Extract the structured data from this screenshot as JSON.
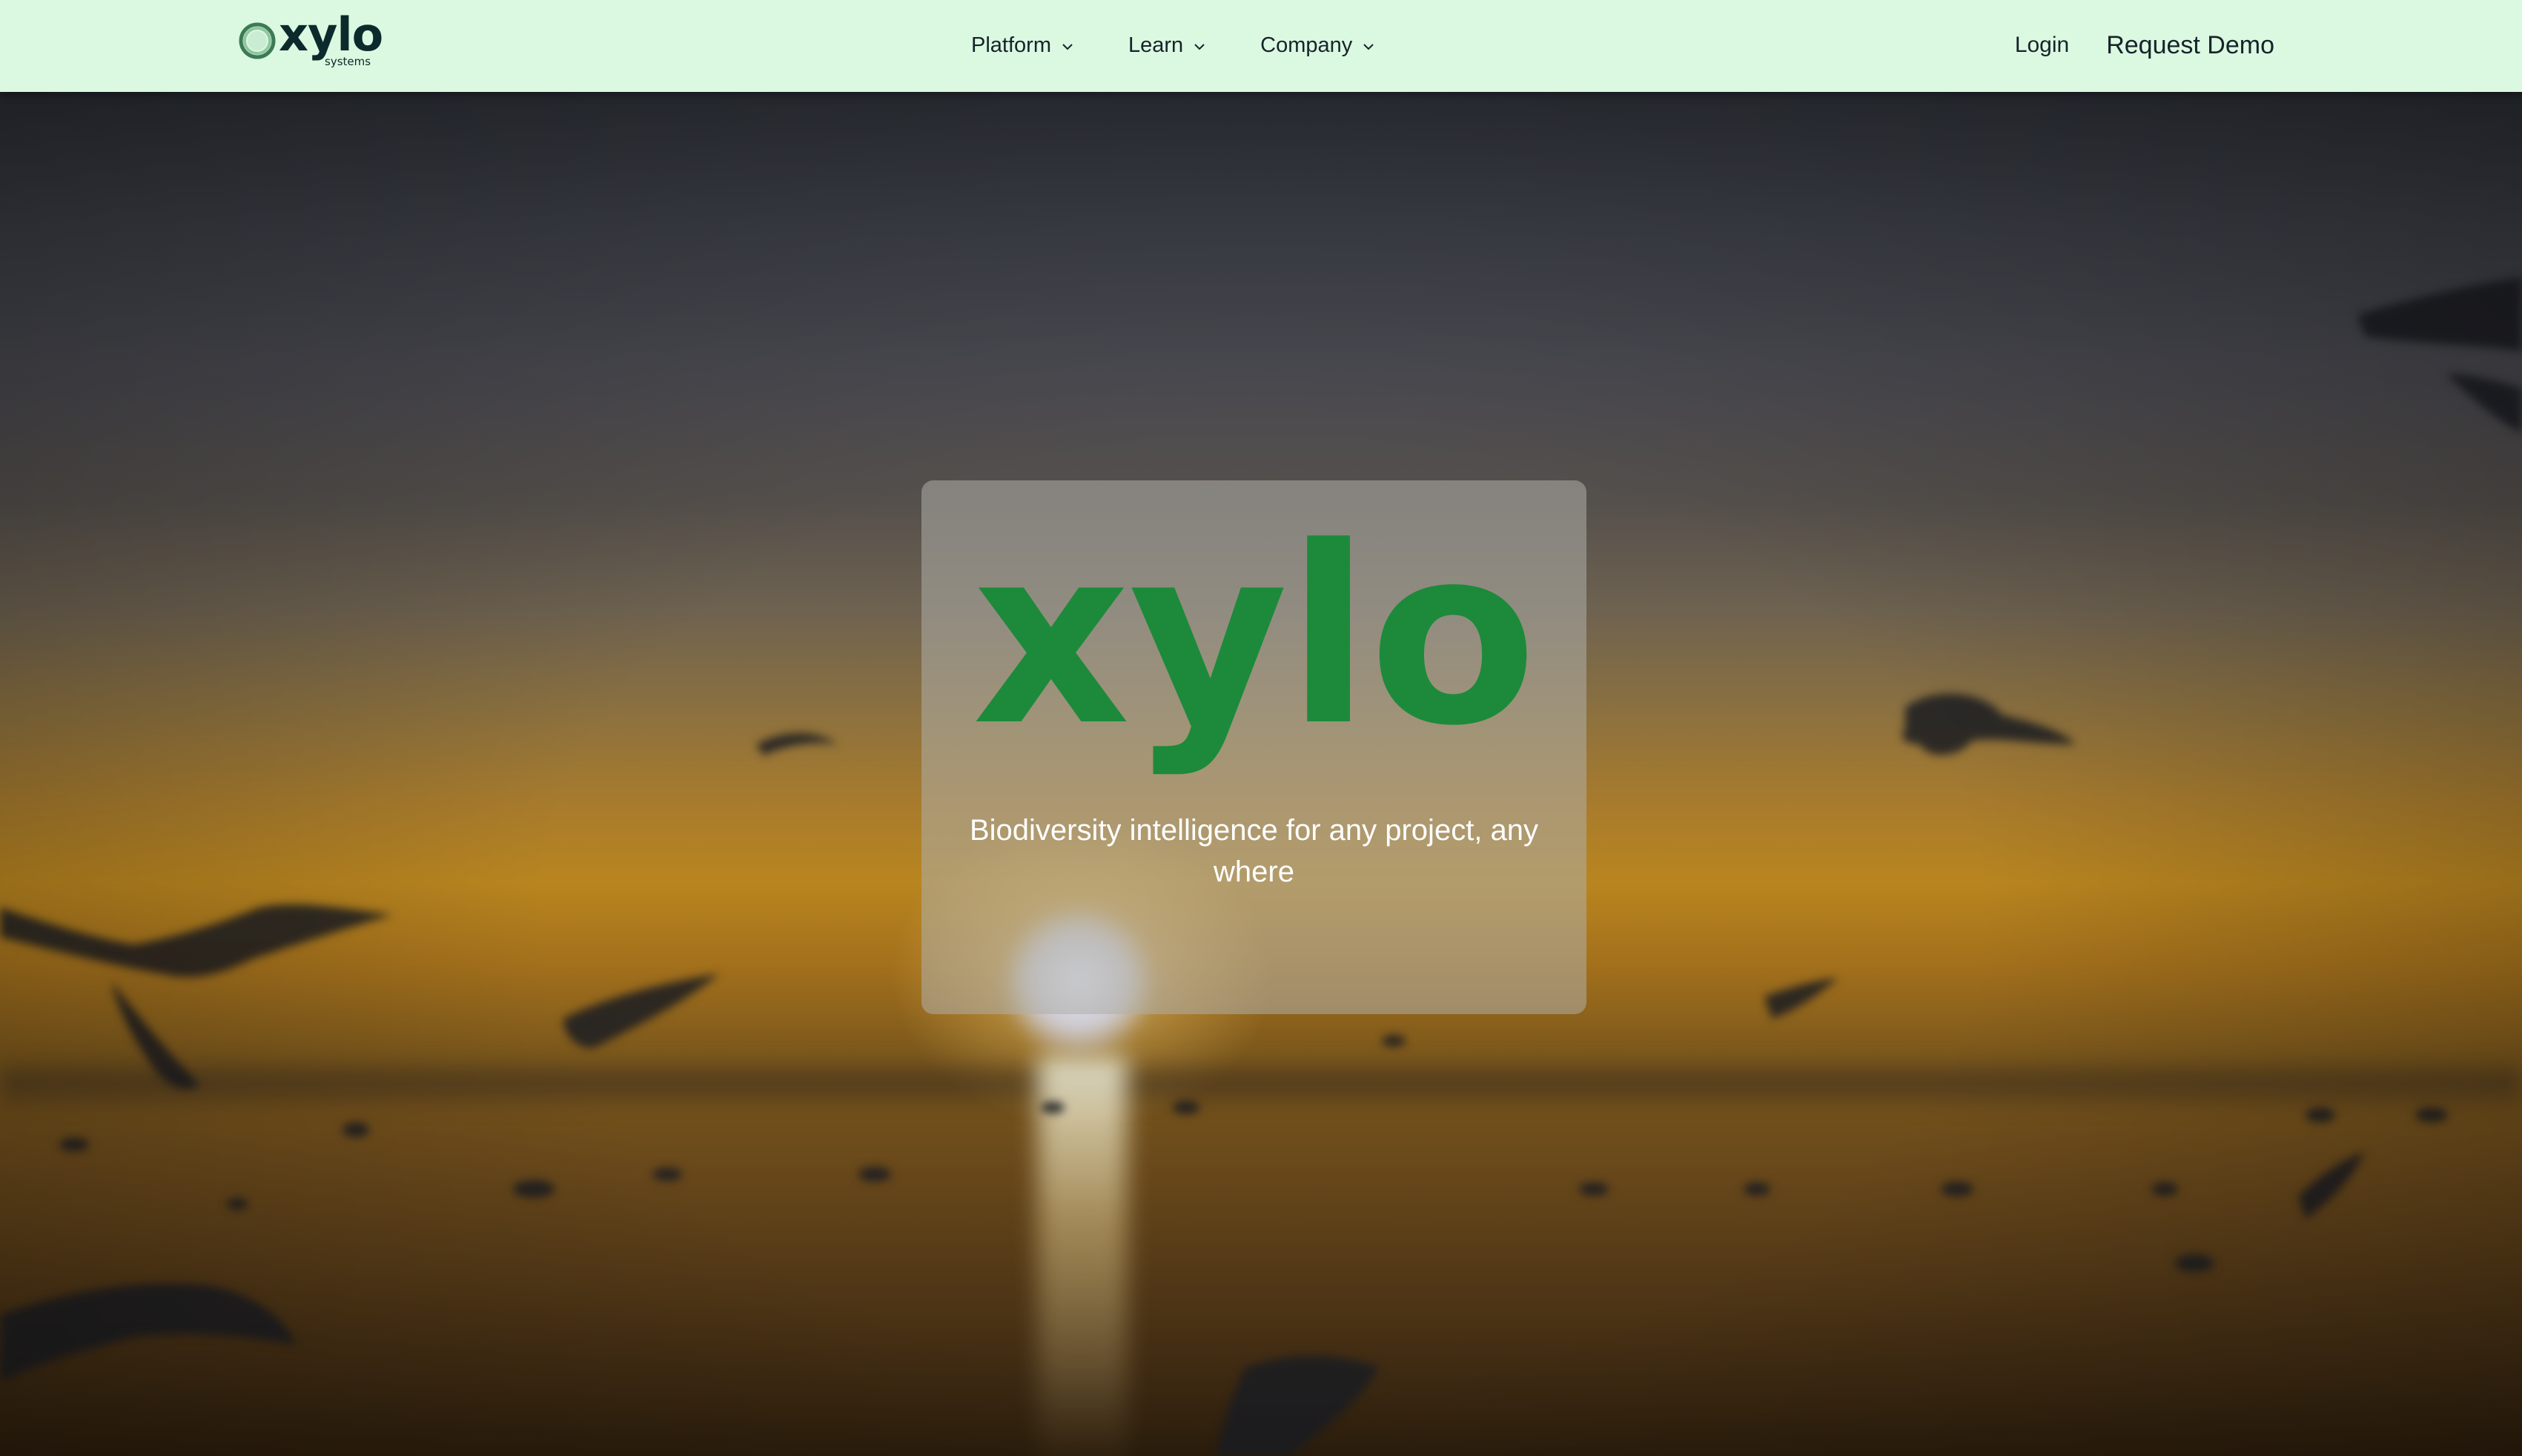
{
  "brand": {
    "wordmark": "xylo",
    "subword": "systems",
    "accent_color": "#1c8a3a",
    "navbar_color": "#dbf8e1"
  },
  "nav": {
    "items": [
      {
        "label": "Platform",
        "icon": "chevron-down-icon"
      },
      {
        "label": "Learn",
        "icon": "chevron-down-icon"
      },
      {
        "label": "Company",
        "icon": "chevron-down-icon"
      }
    ],
    "login_label": "Login",
    "demo_label": "Request Demo"
  },
  "hero": {
    "logo_text": "xylo",
    "tagline": "Biodiversity intelligence for any project, any where",
    "background": "blurred sunset over sea with flying birds"
  }
}
